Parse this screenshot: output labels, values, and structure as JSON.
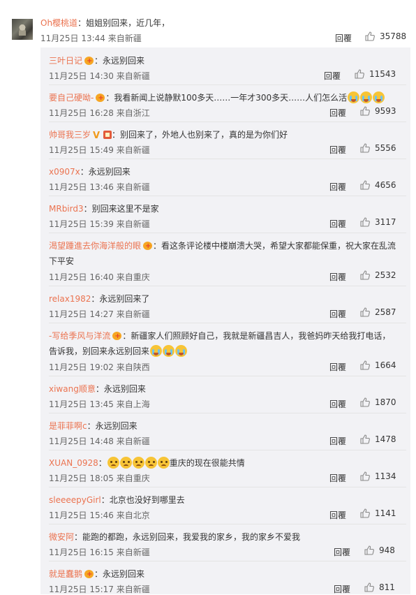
{
  "main_comment": {
    "username": "Oh樱桃道",
    "text": "：姐姐别回来，近几年，",
    "meta": "11月25日 13:44 来自新疆",
    "reply_label": "回覆",
    "likes": "35788"
  },
  "replies": [
    {
      "username": "三叶日记",
      "badges": [
        "badge"
      ],
      "text": "：永远别回来",
      "meta": "11月25日 14:30 来自新疆",
      "reply_label": "回覆",
      "likes": "11543"
    },
    {
      "username": "要自己硬呦-",
      "badges": [
        "badge"
      ],
      "text": "：我看新闻上说静默100多天……一年才300多天……人们怎么活",
      "emojis": [
        "cry-emoji",
        "cry-emoji",
        "cry-emoji"
      ],
      "meta": "11月25日 16:28 来自浙江",
      "reply_label": "回覆",
      "likes": "9593"
    },
    {
      "username": "帅哥我三岁",
      "badges": [
        "vip",
        "flag"
      ],
      "text": "：别回来了，外地人也别来了，真的是为你们好",
      "meta": "11月25日 15:49 来自新疆",
      "reply_label": "回覆",
      "likes": "5556"
    },
    {
      "username": "x0907x",
      "badges": [],
      "text": "：永远别回来",
      "meta": "11月25日 13:46 来自新疆",
      "reply_label": "回覆",
      "likes": "4656"
    },
    {
      "username": "MRbird3",
      "badges": [],
      "text": "：别回来这里不是家",
      "meta": "11月25日 15:39 来自新疆",
      "reply_label": "回覆",
      "likes": "3117"
    },
    {
      "username": "渴望踵進去你海洋般的眼",
      "badges": [
        "badge"
      ],
      "text": "：看这条评论楼中楼崩溃大哭，希望大家都能保重，祝大家在乱流下平安",
      "meta": "11月25日 16:40 来自重庆",
      "reply_label": "回覆",
      "likes": "2532"
    },
    {
      "username": "relax1982",
      "badges": [],
      "text": "：永远别回来了",
      "meta": "11月25日 14:27 来自新疆",
      "reply_label": "回覆",
      "likes": "2587"
    },
    {
      "username": "-写给季风与洋流",
      "badges": [
        "badge"
      ],
      "text": "：新疆家人们照顾好自己，我就是新疆昌吉人，我爸妈昨天给我打电话，告诉我，别回来永远别回来",
      "emojis": [
        "cry-emoji",
        "cry-emoji",
        "cry-emoji"
      ],
      "meta": "11月25日 19:02 来自陕西",
      "reply_label": "回覆",
      "likes": "1664"
    },
    {
      "username": "xiwang顺意",
      "badges": [],
      "text": "：永远别回来",
      "meta": "11月25日 13:45 来自上海",
      "reply_label": "回覆",
      "likes": "1870"
    },
    {
      "username": "是菲菲啊c",
      "badges": [],
      "text": "：永远别回来",
      "meta": "11月25日 14:48 来自新疆",
      "reply_label": "回覆",
      "likes": "1478"
    },
    {
      "username": "XUAN_0928",
      "badges": [],
      "text": "重庆的现在很能共情",
      "lead_emojis": [
        "sad-emoji",
        "sad-emoji",
        "sad-emoji",
        "sad-emoji",
        "sad-emoji"
      ],
      "meta": "11月25日 18:05 来自重庆",
      "reply_label": "回覆",
      "likes": "1134"
    },
    {
      "username": "sleeeepyGirl",
      "badges": [],
      "text": "：北京也没好到哪里去",
      "meta": "11月25日 15:46 来自北京",
      "reply_label": "回覆",
      "likes": "1141"
    },
    {
      "username": "微安阿",
      "badges": [],
      "text": "：能跑的都跑，永远别回来，我爱我的家乡，我的家乡不爱我",
      "meta": "11月25日 16:15 来自新疆",
      "reply_label": "回覆",
      "likes": "948"
    },
    {
      "username": "就是蠢鹅",
      "badges": [
        "badge"
      ],
      "text": "：永远别回来",
      "meta": "11月25日 15:17 来自新疆",
      "reply_label": "回覆",
      "likes": "811"
    }
  ],
  "colors": {
    "username": "#eb7350",
    "meta": "#666666",
    "sub_bg": "#f2f2f5"
  }
}
